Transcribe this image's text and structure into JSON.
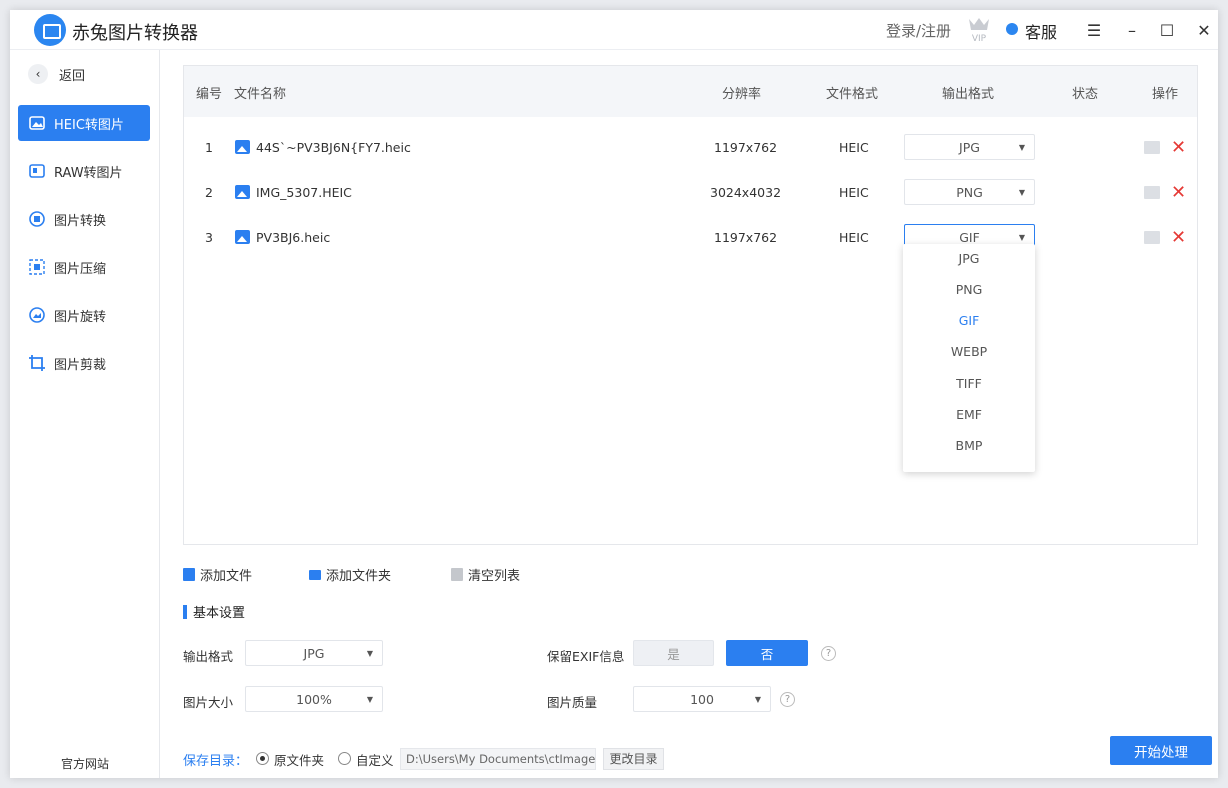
{
  "app": {
    "title": "赤兔图片转换器",
    "login": "登录/注册",
    "vip": "VIP",
    "service": "客服"
  },
  "window_controls": {
    "menu": "☰",
    "minimize": "–",
    "maximize": "☐",
    "close": "✕"
  },
  "sidebar": {
    "back": "返回",
    "items": [
      {
        "label": "HEIC转图片",
        "icon": "heic-icon",
        "active": true
      },
      {
        "label": "RAW转图片",
        "icon": "raw-icon"
      },
      {
        "label": "图片转换",
        "icon": "convert-icon"
      },
      {
        "label": "图片压缩",
        "icon": "compress-icon"
      },
      {
        "label": "图片旋转",
        "icon": "rotate-icon"
      },
      {
        "label": "图片剪裁",
        "icon": "crop-icon"
      }
    ],
    "footer": "官方网站"
  },
  "table": {
    "headers": {
      "num": "编号",
      "name": "文件名称",
      "res": "分辨率",
      "format": "文件格式",
      "output": "输出格式",
      "status": "状态",
      "ops": "操作"
    },
    "rows": [
      {
        "num": "1",
        "name": "44S`~PV3BJ6N{FY7.heic",
        "res": "1197x762",
        "format": "HEIC",
        "output": "JPG",
        "status": ""
      },
      {
        "num": "2",
        "name": "IMG_5307.HEIC",
        "res": "3024x4032",
        "format": "HEIC",
        "output": "PNG",
        "status": ""
      },
      {
        "num": "3",
        "name": "PV3BJ6.heic",
        "res": "1197x762",
        "format": "HEIC",
        "output": "GIF",
        "status": ""
      }
    ]
  },
  "dropdown": {
    "options": [
      "JPG",
      "PNG",
      "GIF",
      "WEBP",
      "TIFF",
      "EMF",
      "BMP"
    ],
    "selected": "GIF"
  },
  "toolbar": {
    "add_file": "添加文件",
    "add_folder": "添加文件夹",
    "clear": "清空列表"
  },
  "settings": {
    "title": "基本设置",
    "output_format_label": "输出格式",
    "output_format": "JPG",
    "exif_label": "保留EXIF信息",
    "exif_yes": "是",
    "exif_no": "否",
    "exif_selected": "否",
    "size_label": "图片大小",
    "size": "100%",
    "quality_label": "图片质量",
    "quality": "100"
  },
  "save": {
    "label": "保存目录：",
    "option_original": "原文件夹",
    "option_custom": "自定义",
    "selected": "原文件夹",
    "path": "D:\\Users\\My Documents\\ctImageC",
    "change_dir": "更改目录"
  },
  "start_button": "开始处理",
  "colors": {
    "accent": "#2b7ff0",
    "delete": "#e53935"
  }
}
